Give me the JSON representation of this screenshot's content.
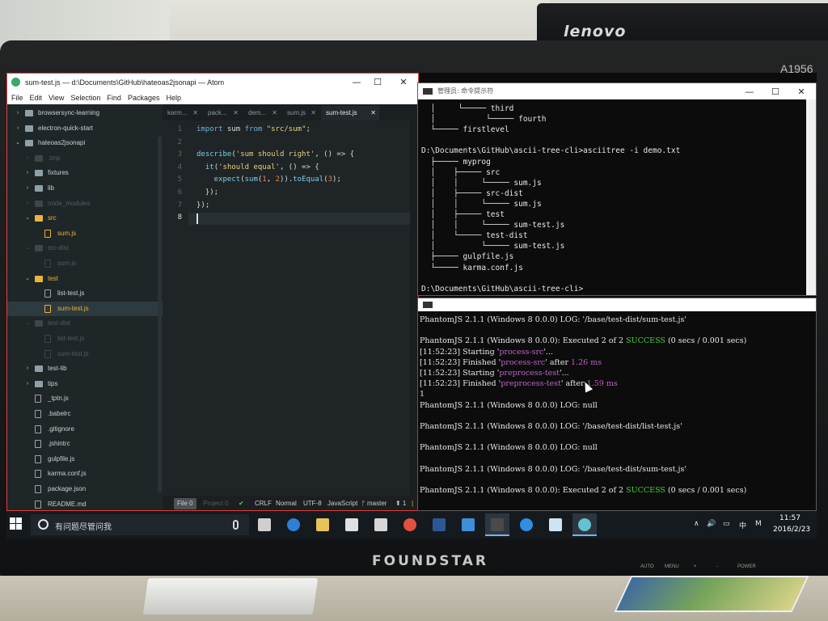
{
  "environment": {
    "background_monitor_brand": "lenovo",
    "model_label": "A1956",
    "monitor_brand": "FOUNDSTAR",
    "monitor_buttons": [
      "AUTO",
      "MENU",
      "+",
      "-",
      "POWER"
    ]
  },
  "atom": {
    "title": "sum-test.js — d:\\Documents\\GitHub\\hateoas2jsonapi — Atom",
    "controls": {
      "minimize": "—",
      "maximize": "☐",
      "close": "✕"
    },
    "menu": [
      "File",
      "Edit",
      "View",
      "Selection",
      "Find",
      "Packages",
      "Help"
    ],
    "tree": [
      {
        "label": "browsersync-learning",
        "kind": "folder",
        "chev": "›",
        "state": "normal"
      },
      {
        "label": "electron-quick-start",
        "kind": "folder",
        "chev": "›",
        "state": "normal"
      },
      {
        "label": "hateoas2jsonapi",
        "kind": "folder",
        "chev": "⌄",
        "state": "normal"
      },
      {
        "label": ".tmp",
        "kind": "folder",
        "chev": "›",
        "state": "dim"
      },
      {
        "label": "fixtures",
        "kind": "folder",
        "chev": "›",
        "state": "normal"
      },
      {
        "label": "lib",
        "kind": "folder",
        "chev": "›",
        "state": "normal"
      },
      {
        "label": "node_modules",
        "kind": "folder",
        "chev": "›",
        "state": "dim"
      },
      {
        "label": "src",
        "kind": "folder",
        "chev": "⌄",
        "state": "hl"
      },
      {
        "label": "sum.js",
        "kind": "file",
        "chev": "",
        "state": "hl"
      },
      {
        "label": "src-dist",
        "kind": "folder",
        "chev": "⌄",
        "state": "dim"
      },
      {
        "label": "sum.js",
        "kind": "file",
        "chev": "",
        "state": "dim"
      },
      {
        "label": "test",
        "kind": "folder",
        "chev": "⌄",
        "state": "hl"
      },
      {
        "label": "list-test.js",
        "kind": "file",
        "chev": "",
        "state": "normal"
      },
      {
        "label": "sum-test.js",
        "kind": "file",
        "chev": "",
        "state": "hl-sel"
      },
      {
        "label": "test-dist",
        "kind": "folder",
        "chev": "⌄",
        "state": "dim"
      },
      {
        "label": "list-test.js",
        "kind": "file",
        "chev": "",
        "state": "dim"
      },
      {
        "label": "sum-test.js",
        "kind": "file",
        "chev": "",
        "state": "dim"
      },
      {
        "label": "test-lib",
        "kind": "folder",
        "chev": "›",
        "state": "normal"
      },
      {
        "label": "tips",
        "kind": "folder",
        "chev": "›",
        "state": "normal"
      },
      {
        "label": "_tptn.js",
        "kind": "file",
        "chev": "",
        "state": "normal"
      },
      {
        "label": ".babelrc",
        "kind": "file",
        "chev": "",
        "state": "normal"
      },
      {
        "label": ".gitignore",
        "kind": "file",
        "chev": "",
        "state": "normal"
      },
      {
        "label": ".jshintrc",
        "kind": "file",
        "chev": "",
        "state": "normal"
      },
      {
        "label": "gulpfile.js",
        "kind": "file",
        "chev": "",
        "state": "normal"
      },
      {
        "label": "karma.conf.js",
        "kind": "file",
        "chev": "",
        "state": "normal"
      },
      {
        "label": "package.json",
        "kind": "file",
        "chev": "",
        "state": "normal"
      },
      {
        "label": "README.md",
        "kind": "file",
        "chev": "",
        "state": "normal"
      }
    ],
    "tabs": [
      {
        "label": "karm...",
        "active": false
      },
      {
        "label": "pack...",
        "active": false
      },
      {
        "label": "dem...",
        "active": false
      },
      {
        "label": "sum.js",
        "active": false
      },
      {
        "label": "sum-test.js",
        "active": true
      }
    ],
    "tab_close": "✕",
    "line_numbers": [
      "1",
      "2",
      "3",
      "4",
      "5",
      "6",
      "7",
      "8"
    ],
    "code": [
      [
        {
          "t": "import ",
          "c": "kw"
        },
        {
          "t": "sum ",
          "c": ""
        },
        {
          "t": "from ",
          "c": "kw"
        },
        {
          "t": "\"src/sum\"",
          "c": "str"
        },
        {
          "t": ";",
          "c": ""
        }
      ],
      [],
      [
        {
          "t": "describe",
          "c": "fn"
        },
        {
          "t": "(",
          "c": ""
        },
        {
          "t": "'sum should right'",
          "c": "str"
        },
        {
          "t": ", () => {",
          "c": ""
        }
      ],
      [
        {
          "t": "  it",
          "c": "fn"
        },
        {
          "t": "(",
          "c": ""
        },
        {
          "t": "'should equal'",
          "c": "str"
        },
        {
          "t": ", () => {",
          "c": ""
        }
      ],
      [
        {
          "t": "    expect",
          "c": "fn"
        },
        {
          "t": "(",
          "c": ""
        },
        {
          "t": "sum",
          "c": "fn"
        },
        {
          "t": "(",
          "c": ""
        },
        {
          "t": "1",
          "c": "num"
        },
        {
          "t": ", ",
          "c": ""
        },
        {
          "t": "2",
          "c": "num"
        },
        {
          "t": ")).",
          "c": ""
        },
        {
          "t": "toEqual",
          "c": "fn"
        },
        {
          "t": "(",
          "c": ""
        },
        {
          "t": "3",
          "c": "num"
        },
        {
          "t": ");",
          "c": ""
        }
      ],
      [
        {
          "t": "  });",
          "c": ""
        }
      ],
      [
        {
          "t": "});",
          "c": ""
        }
      ],
      []
    ],
    "status": {
      "file": "File 0",
      "project": "Project 0",
      "ok_mark": "✔",
      "line_ending": "CRLF",
      "mode": "Normal",
      "encoding": "UTF-8",
      "grammar": "JavaScript",
      "branch": "ᚠ master",
      "ahead": "⬆ 1",
      "sep": "|"
    }
  },
  "terminal_top": {
    "title": "管理员: 命令提示符",
    "controls": {
      "minimize": "—",
      "maximize": "☐",
      "close": "✕"
    },
    "lines": [
      "  │     └───── third",
      "  │           └───── fourth",
      "  └───── firstlevel",
      "",
      "D:\\Documents\\GitHub\\ascii-tree-cli>asciitree -i demo.txt",
      "  ├───── myprog",
      "  │    ├───── src",
      "  │    │     └───── sum.js",
      "  │    ├───── src-dist",
      "  │    │     └───── sum.js",
      "  │    ├───── test",
      "  │    │     └───── sum-test.js",
      "  │    └───── test-dist",
      "  │          └───── sum-test.js",
      "  ├───── gulpfile.js",
      "  └───── karma.conf.js",
      "",
      "D:\\Documents\\GitHub\\ascii-tree-cli>"
    ]
  },
  "terminal_bottom": {
    "lines": [
      [
        {
          "t": "PhantomJS 2.1.1 (Windows 8 0.0.0) LOG: ",
          "c": ""
        },
        {
          "t": "'/base/test-dist/sum-test.js'",
          "c": ""
        }
      ],
      [],
      [
        {
          "t": "PhantomJS 2.1.1 (Windows 8 0.0.0): Executed 2 of 2 ",
          "c": ""
        },
        {
          "t": "SUCCESS",
          "c": "grn"
        },
        {
          "t": " (0 secs / 0.001 secs)",
          "c": ""
        }
      ],
      [
        {
          "t": "[11:52:23] Starting '",
          "c": ""
        },
        {
          "t": "process-src",
          "c": "mag"
        },
        {
          "t": "'...",
          "c": ""
        }
      ],
      [
        {
          "t": "[11:52:23] Finished '",
          "c": ""
        },
        {
          "t": "process-src",
          "c": "mag"
        },
        {
          "t": "' after ",
          "c": ""
        },
        {
          "t": "1.26 ms",
          "c": "mag"
        }
      ],
      [
        {
          "t": "[11:52:23] Starting '",
          "c": ""
        },
        {
          "t": "preprocess-test",
          "c": "mag"
        },
        {
          "t": "'...",
          "c": ""
        }
      ],
      [
        {
          "t": "[11:52:23] Finished '",
          "c": ""
        },
        {
          "t": "preprocess-test",
          "c": "mag"
        },
        {
          "t": "' after ",
          "c": ""
        },
        {
          "t": "1.59 ms",
          "c": "mag"
        }
      ],
      [
        {
          "t": "1",
          "c": ""
        }
      ],
      [
        {
          "t": "PhantomJS 2.1.1 (Windows 8 0.0.0) LOG: null",
          "c": ""
        }
      ],
      [],
      [
        {
          "t": "PhantomJS 2.1.1 (Windows 8 0.0.0) LOG: '/base/test-dist/list-test.js'",
          "c": ""
        }
      ],
      [],
      [
        {
          "t": "PhantomJS 2.1.1 (Windows 8 0.0.0) LOG: null",
          "c": ""
        }
      ],
      [],
      [
        {
          "t": "PhantomJS 2.1.1 (Windows 8 0.0.0) LOG: '/base/test-dist/sum-test.js'",
          "c": ""
        }
      ],
      [],
      [
        {
          "t": "PhantomJS 2.1.1 (Windows 8 0.0.0): Executed 2 of 2 ",
          "c": ""
        },
        {
          "t": "SUCCESS",
          "c": "grn"
        },
        {
          "t": " (0 secs / 0.001 secs)",
          "c": ""
        }
      ]
    ]
  },
  "taskbar": {
    "search_placeholder": "有问题尽管问我",
    "apps": [
      {
        "name": "task-view",
        "color": "#cfcfcf",
        "active": false
      },
      {
        "name": "edge",
        "color": "#2f7fd6",
        "active": false
      },
      {
        "name": "file-explorer",
        "color": "#e8c25a",
        "active": false
      },
      {
        "name": "store",
        "color": "#e0e0e0",
        "active": false
      },
      {
        "name": "calculator",
        "color": "#d6d6d6",
        "active": false
      },
      {
        "name": "chrome",
        "color": "#e0523f",
        "active": false
      },
      {
        "name": "word",
        "color": "#2b5797",
        "active": false
      },
      {
        "name": "xshell",
        "color": "#3d8fd9",
        "active": false
      },
      {
        "name": "cmd",
        "color": "#4a4a4a",
        "active": true
      },
      {
        "name": "internet-explorer",
        "color": "#2f8fe0",
        "active": false
      },
      {
        "name": "store-bag",
        "color": "#cfe4f2",
        "active": false
      },
      {
        "name": "atom",
        "color": "#62c2d0",
        "active": true
      }
    ],
    "tray": {
      "up": "∧",
      "volume": "🔊",
      "message": "▭",
      "ime": "中",
      "ime_mode": "M"
    },
    "time": "11:57",
    "date": "2016/2/23"
  }
}
